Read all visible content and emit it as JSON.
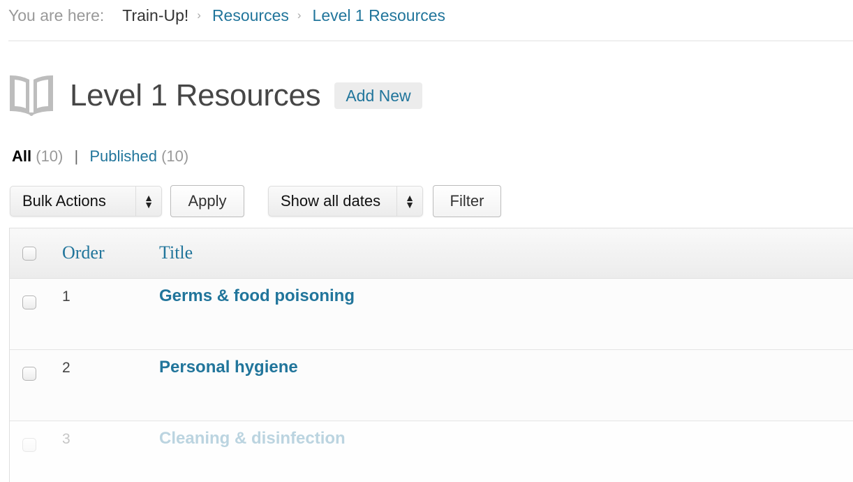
{
  "breadcrumb": {
    "prefix": "You are here:",
    "home": "Train-Up!",
    "separator": "›",
    "resources": "Resources",
    "current": "Level 1 Resources"
  },
  "header": {
    "icon": "book-icon",
    "title": "Level 1 Resources",
    "add_new": "Add New"
  },
  "filters": {
    "all_label": "All",
    "all_count": "(10)",
    "separator": "|",
    "published_label": "Published",
    "published_count": "(10)"
  },
  "tablenav": {
    "bulk_actions": "Bulk Actions",
    "apply": "Apply",
    "dates": "Show all dates",
    "filter": "Filter"
  },
  "table": {
    "columns": {
      "order": "Order",
      "title": "Title"
    },
    "rows": [
      {
        "order": "1",
        "title": "Germs & food poisoning"
      },
      {
        "order": "2",
        "title": "Personal hygiene"
      },
      {
        "order": "3",
        "title": "Cleaning & disinfection"
      }
    ]
  },
  "colors": {
    "link": "#21759b",
    "muted": "#999999",
    "border": "#dfdfdf"
  }
}
